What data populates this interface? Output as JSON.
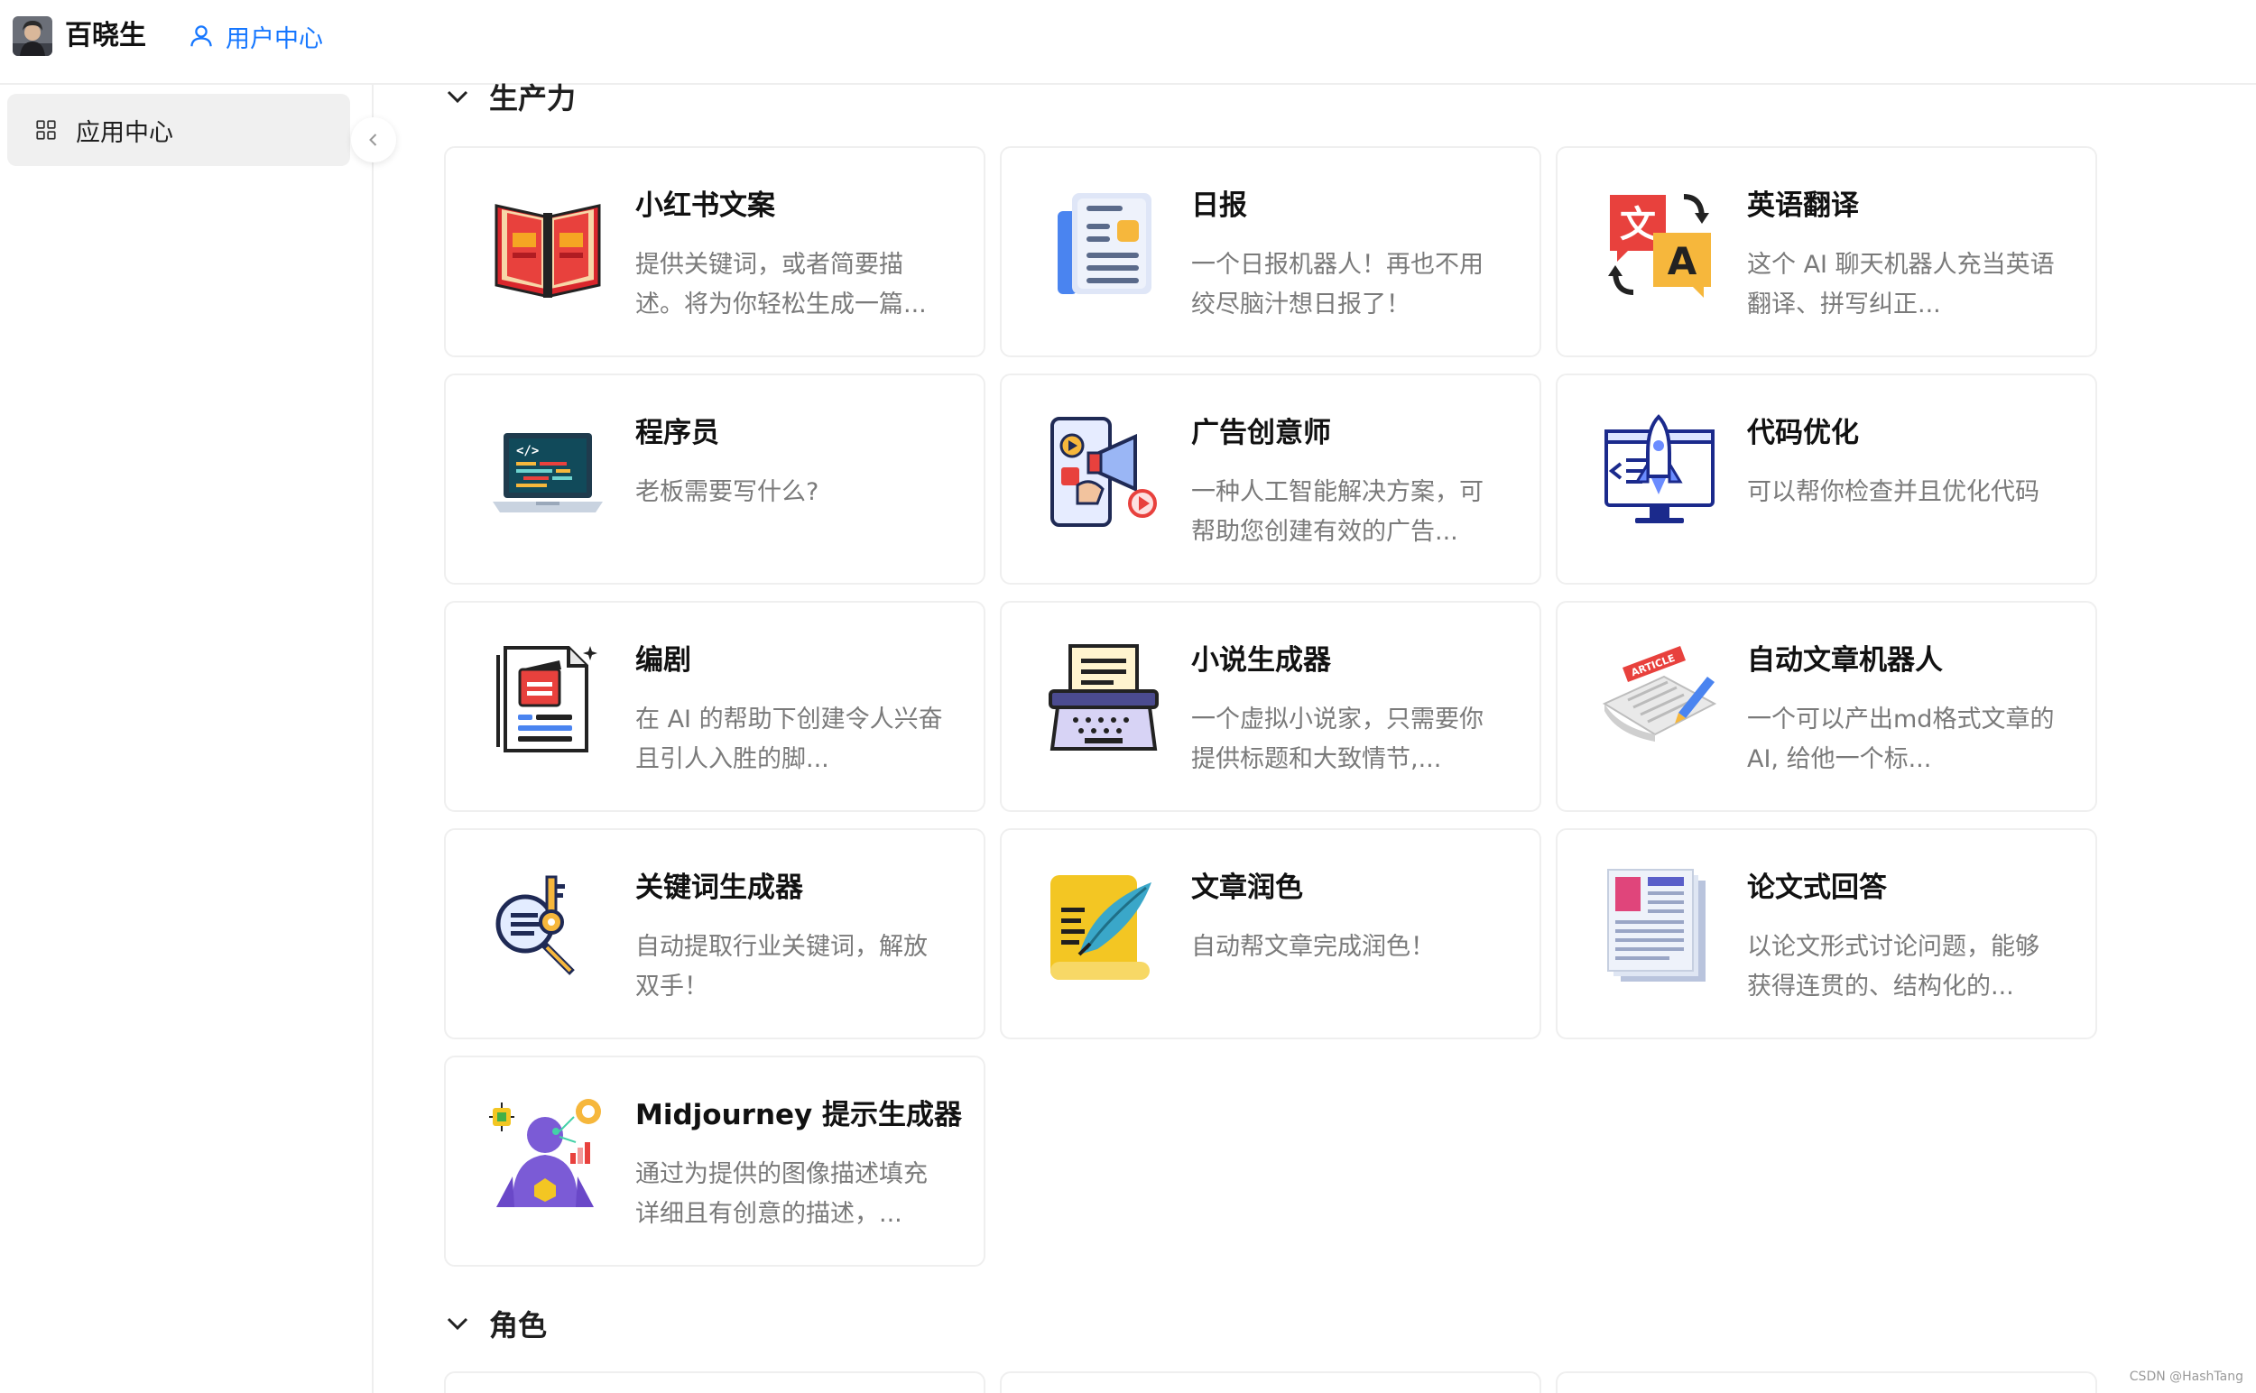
{
  "header": {
    "brand": "百晓生",
    "user_center_label": "用户中心"
  },
  "sidebar": {
    "items": [
      {
        "label": "应用中心",
        "icon": "grid-icon",
        "active": true
      }
    ],
    "collapse_icon": "chevron-left-icon"
  },
  "sections": [
    {
      "title": "生产力",
      "expanded": true
    },
    {
      "title": "角色",
      "expanded": true
    }
  ],
  "apps": [
    {
      "title": "小红书文案",
      "desc": "提供关键词，或者简要描述。将为你轻松生成一篇...",
      "icon": "open-book-icon"
    },
    {
      "title": "日报",
      "desc": "一个日报机器人！再也不用绞尽脑汁想日报了！",
      "icon": "daily-report-icon"
    },
    {
      "title": "英语翻译",
      "desc": "这个 AI 聊天机器人充当英语翻译、拼写纠正...",
      "icon": "translate-icon"
    },
    {
      "title": "程序员",
      "desc": "老板需要写什么?",
      "icon": "laptop-code-icon"
    },
    {
      "title": "广告创意师",
      "desc": "一种人工智能解决方案，可帮助您创建有效的广告...",
      "icon": "megaphone-phone-icon"
    },
    {
      "title": "代码优化",
      "desc": "可以帮你检查并且优化代码",
      "icon": "monitor-rocket-icon"
    },
    {
      "title": "编剧",
      "desc": "在 AI 的帮助下创建令人兴奋且引人入胜的脚...",
      "icon": "script-clapper-icon"
    },
    {
      "title": "小说生成器",
      "desc": "一个虚拟小说家，只需要你提供标题和大致情节,...",
      "icon": "typewriter-icon"
    },
    {
      "title": "自动文章机器人",
      "desc": "一个可以产出md格式文章的AI, 给他一个标...",
      "icon": "article-pen-icon"
    },
    {
      "title": "关键词生成器",
      "desc": "自动提取行业关键词，解放双手！",
      "icon": "key-magnifier-icon"
    },
    {
      "title": "文章润色",
      "desc": "自动帮文章完成润色！",
      "icon": "scroll-quill-icon"
    },
    {
      "title": "论文式回答",
      "desc": "以论文形式讨论问题，能够获得连贯的、结构化的...",
      "icon": "paper-document-icon"
    },
    {
      "title": "Midjourney 提示生成器",
      "desc": "通过为提供的图像描述填充详细且有创意的描述，...",
      "icon": "ai-humanoid-icon"
    }
  ],
  "watermark": "CSDN @HashTang",
  "colors": {
    "accent": "#1677ff",
    "sidebar_active_bg": "#f0f0f0",
    "desc_text": "#7a7a7a",
    "border": "#efefef"
  }
}
